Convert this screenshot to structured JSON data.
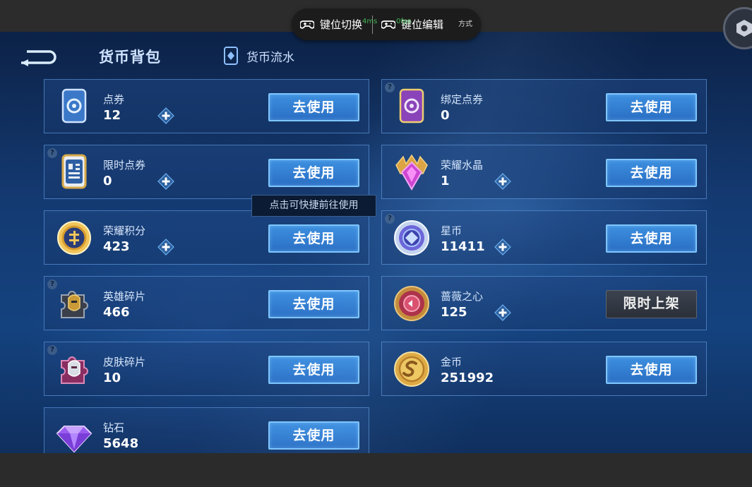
{
  "toolbar": {
    "key_switch_label": "键位切换",
    "key_edit_label": "键位编辑",
    "ghost_latency": "4ms",
    "ghost_fps": "0fps",
    "ghost_method": "方式"
  },
  "header": {
    "title": "货币背包",
    "flow_tab_label": "货币流水"
  },
  "tooltip": "点击可快捷前往使用",
  "cards": [
    {
      "name": "点券",
      "value": "12",
      "button": "去使用",
      "has_plus": true,
      "has_help": false,
      "icon": "coupon-icon"
    },
    {
      "name": "绑定点券",
      "value": "0",
      "button": "去使用",
      "has_plus": false,
      "has_help": true,
      "icon": "bound-coupon-icon"
    },
    {
      "name": "限时点券",
      "value": "0",
      "button": "去使用",
      "has_plus": true,
      "has_help": true,
      "icon": "limited-coupon-icon"
    },
    {
      "name": "荣耀水晶",
      "value": "1",
      "button": "去使用",
      "has_plus": true,
      "has_help": false,
      "icon": "glory-crystal-icon"
    },
    {
      "name": "荣耀积分",
      "value": "423",
      "button": "去使用",
      "has_plus": true,
      "has_help": false,
      "icon": "glory-points-icon"
    },
    {
      "name": "星币",
      "value": "11411",
      "button": "去使用",
      "has_plus": true,
      "has_help": true,
      "icon": "star-coin-icon"
    },
    {
      "name": "英雄碎片",
      "value": "466",
      "button": "去使用",
      "has_plus": false,
      "has_help": true,
      "icon": "hero-fragment-icon"
    },
    {
      "name": "蔷薇之心",
      "value": "125",
      "button": "限时上架",
      "has_plus": true,
      "has_help": false,
      "icon": "rose-heart-icon"
    },
    {
      "name": "皮肤碎片",
      "value": "10",
      "button": "去使用",
      "has_plus": false,
      "has_help": true,
      "icon": "skin-fragment-icon"
    },
    {
      "name": "金币",
      "value": "251992",
      "button": "去使用",
      "has_plus": false,
      "has_help": false,
      "icon": "gold-coin-icon"
    },
    {
      "name": "钻石",
      "value": "5648",
      "button": "去使用",
      "has_plus": false,
      "has_help": false,
      "icon": "diamond-icon"
    }
  ],
  "help_mark": "?"
}
